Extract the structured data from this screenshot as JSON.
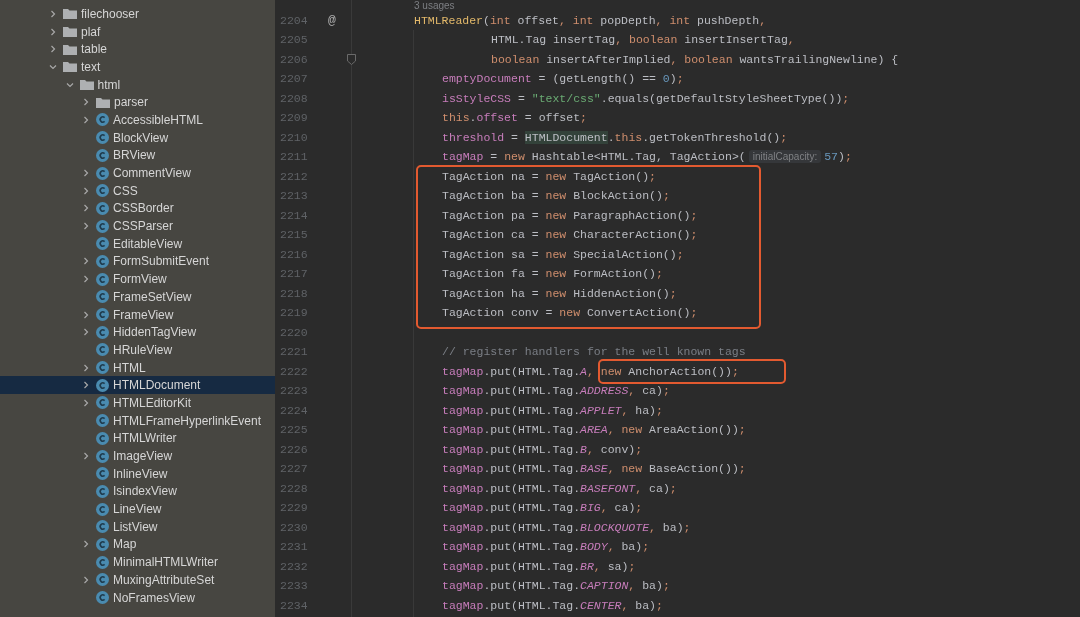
{
  "project_tree": {
    "items": [
      {
        "label": "filechooser",
        "kind": "folder",
        "expanded": false,
        "selected": false
      },
      {
        "label": "plaf",
        "kind": "folder",
        "expanded": false,
        "selected": false
      },
      {
        "label": "table",
        "kind": "folder",
        "expanded": false,
        "selected": false
      },
      {
        "label": "text",
        "kind": "folder",
        "expanded": true,
        "selected": false,
        "children": [
          {
            "label": "html",
            "kind": "folder",
            "expanded": true,
            "selected": false,
            "children": [
              {
                "label": "parser",
                "kind": "folder",
                "expanded": false,
                "selected": false
              },
              {
                "label": "AccessibleHTML",
                "kind": "class",
                "expanded": false,
                "selected": false
              },
              {
                "label": "BlockView",
                "kind": "class",
                "selected": false
              },
              {
                "label": "BRView",
                "kind": "class",
                "selected": false
              },
              {
                "label": "CommentView",
                "kind": "class",
                "expanded": false,
                "selected": false
              },
              {
                "label": "CSS",
                "kind": "class",
                "expanded": false,
                "selected": false
              },
              {
                "label": "CSSBorder",
                "kind": "class",
                "expanded": false,
                "selected": false
              },
              {
                "label": "CSSParser",
                "kind": "class",
                "expanded": false,
                "selected": false
              },
              {
                "label": "EditableView",
                "kind": "class",
                "selected": false
              },
              {
                "label": "FormSubmitEvent",
                "kind": "class",
                "expanded": false,
                "selected": false
              },
              {
                "label": "FormView",
                "kind": "class",
                "expanded": false,
                "selected": false
              },
              {
                "label": "FrameSetView",
                "kind": "class",
                "selected": false
              },
              {
                "label": "FrameView",
                "kind": "class",
                "expanded": false,
                "selected": false
              },
              {
                "label": "HiddenTagView",
                "kind": "class",
                "expanded": false,
                "selected": false
              },
              {
                "label": "HRuleView",
                "kind": "class",
                "selected": false
              },
              {
                "label": "HTML",
                "kind": "class",
                "expanded": false,
                "selected": false
              },
              {
                "label": "HTMLDocument",
                "kind": "class",
                "expanded": false,
                "selected": true
              },
              {
                "label": "HTMLEditorKit",
                "kind": "class",
                "expanded": false,
                "selected": false
              },
              {
                "label": "HTMLFrameHyperlinkEvent",
                "kind": "class",
                "selected": false
              },
              {
                "label": "HTMLWriter",
                "kind": "class",
                "selected": false
              },
              {
                "label": "ImageView",
                "kind": "class",
                "expanded": false,
                "selected": false
              },
              {
                "label": "InlineView",
                "kind": "class",
                "selected": false
              },
              {
                "label": "IsindexView",
                "kind": "class",
                "selected": false
              },
              {
                "label": "LineView",
                "kind": "class",
                "selected": false
              },
              {
                "label": "ListView",
                "kind": "class",
                "selected": false
              },
              {
                "label": "Map",
                "kind": "class",
                "expanded": false,
                "selected": false
              },
              {
                "label": "MinimalHTMLWriter",
                "kind": "class",
                "selected": false
              },
              {
                "label": "MuxingAttributeSet",
                "kind": "class",
                "expanded": false,
                "selected": false
              },
              {
                "label": "NoFramesView",
                "kind": "class",
                "selected": false
              }
            ]
          }
        ]
      }
    ]
  },
  "editor": {
    "usages_hint": "3 usages",
    "lines": [
      {
        "number": "2204",
        "gutter": "@",
        "fold": false,
        "kind": "signature",
        "tokens": [
          {
            "kind": "decl",
            "text": "HTMLReader"
          },
          {
            "kind": "plain",
            "text": "("
          },
          {
            "kind": "keyword",
            "text": "int"
          },
          {
            "kind": "plain",
            "text": " offset"
          },
          {
            "kind": "keyword",
            "text": ", int"
          },
          {
            "kind": "plain",
            "text": " popDepth"
          },
          {
            "kind": "keyword",
            "text": ", int"
          },
          {
            "kind": "plain",
            "text": " pushDepth"
          },
          {
            "kind": "keyword",
            "text": ","
          }
        ]
      },
      {
        "number": "2205",
        "fold": false,
        "kind": "continuation",
        "tokens": [
          {
            "kind": "plain",
            "text": "HTML.Tag insertTag"
          },
          {
            "kind": "keyword",
            "text": ", boolean"
          },
          {
            "kind": "plain",
            "text": " insertInsertTag"
          },
          {
            "kind": "keyword",
            "text": ","
          }
        ]
      },
      {
        "number": "2206",
        "fold": true,
        "kind": "continuation",
        "tokens": [
          {
            "kind": "keyword",
            "text": "boolean"
          },
          {
            "kind": "plain",
            "text": " insertAfterImplied"
          },
          {
            "kind": "keyword",
            "text": ", boolean"
          },
          {
            "kind": "plain",
            "text": " wantsTrailingNewline) {"
          }
        ]
      },
      {
        "number": "2207",
        "fold": false,
        "kind": "body",
        "tokens": [
          {
            "kind": "field",
            "text": "emptyDocument"
          },
          {
            "kind": "plain",
            "text": " = (getLength() == "
          },
          {
            "kind": "number",
            "text": "0"
          },
          {
            "kind": "plain",
            "text": ")"
          },
          {
            "kind": "keyword",
            "text": ";"
          }
        ]
      },
      {
        "number": "2208",
        "fold": false,
        "kind": "body",
        "tokens": [
          {
            "kind": "field",
            "text": "isStyleCSS"
          },
          {
            "kind": "plain",
            "text": " = "
          },
          {
            "kind": "string",
            "text": "\"text/css\""
          },
          {
            "kind": "plain",
            "text": ".equals(getDefaultStyleSheetType())"
          },
          {
            "kind": "keyword",
            "text": ";"
          }
        ]
      },
      {
        "number": "2209",
        "fold": false,
        "kind": "body",
        "tokens": [
          {
            "kind": "keyword",
            "text": "this"
          },
          {
            "kind": "plain",
            "text": "."
          },
          {
            "kind": "field",
            "text": "offset"
          },
          {
            "kind": "plain",
            "text": " = offset"
          },
          {
            "kind": "keyword",
            "text": ";"
          }
        ]
      },
      {
        "number": "2210",
        "fold": false,
        "kind": "body",
        "tokens": [
          {
            "kind": "field",
            "text": "threshold"
          },
          {
            "kind": "plain",
            "text": " = "
          },
          {
            "kind": "highlight",
            "text": "HTMLDocument"
          },
          {
            "kind": "plain",
            "text": "."
          },
          {
            "kind": "keyword",
            "text": "this"
          },
          {
            "kind": "plain",
            "text": ".getTokenThreshold()"
          },
          {
            "kind": "keyword",
            "text": ";"
          }
        ]
      },
      {
        "number": "2211",
        "fold": false,
        "kind": "body",
        "tokens": [
          {
            "kind": "field",
            "text": "tagMap"
          },
          {
            "kind": "plain",
            "text": " = "
          },
          {
            "kind": "keyword",
            "text": "new"
          },
          {
            "kind": "plain",
            "text": " Hashtable<HTML.Tag, TagAction>("
          },
          {
            "kind": "hint",
            "text": "initialCapacity:"
          },
          {
            "kind": "number",
            "text": "57"
          },
          {
            "kind": "plain",
            "text": ")"
          },
          {
            "kind": "keyword",
            "text": ";"
          }
        ]
      },
      {
        "number": "2212",
        "fold": false,
        "kind": "body",
        "tokens": [
          {
            "kind": "plain",
            "text": "TagAction na = "
          },
          {
            "kind": "keyword",
            "text": "new"
          },
          {
            "kind": "plain",
            "text": " TagAction()"
          },
          {
            "kind": "keyword",
            "text": ";"
          }
        ]
      },
      {
        "number": "2213",
        "fold": false,
        "kind": "body",
        "tokens": [
          {
            "kind": "plain",
            "text": "TagAction ba = "
          },
          {
            "kind": "keyword",
            "text": "new"
          },
          {
            "kind": "plain",
            "text": " BlockAction()"
          },
          {
            "kind": "keyword",
            "text": ";"
          }
        ]
      },
      {
        "number": "2214",
        "fold": false,
        "kind": "body",
        "tokens": [
          {
            "kind": "plain",
            "text": "TagAction pa = "
          },
          {
            "kind": "keyword",
            "text": "new"
          },
          {
            "kind": "plain",
            "text": " ParagraphAction()"
          },
          {
            "kind": "keyword",
            "text": ";"
          }
        ]
      },
      {
        "number": "2215",
        "fold": false,
        "kind": "body",
        "tokens": [
          {
            "kind": "plain",
            "text": "TagAction ca = "
          },
          {
            "kind": "keyword",
            "text": "new"
          },
          {
            "kind": "plain",
            "text": " CharacterAction()"
          },
          {
            "kind": "keyword",
            "text": ";"
          }
        ]
      },
      {
        "number": "2216",
        "fold": false,
        "kind": "body",
        "tokens": [
          {
            "kind": "plain",
            "text": "TagAction sa = "
          },
          {
            "kind": "keyword",
            "text": "new"
          },
          {
            "kind": "plain",
            "text": " SpecialAction()"
          },
          {
            "kind": "keyword",
            "text": ";"
          }
        ]
      },
      {
        "number": "2217",
        "fold": false,
        "kind": "body",
        "tokens": [
          {
            "kind": "plain",
            "text": "TagAction fa = "
          },
          {
            "kind": "keyword",
            "text": "new"
          },
          {
            "kind": "plain",
            "text": " FormAction()"
          },
          {
            "kind": "keyword",
            "text": ";"
          }
        ]
      },
      {
        "number": "2218",
        "fold": false,
        "kind": "body",
        "tokens": [
          {
            "kind": "plain",
            "text": "TagAction ha = "
          },
          {
            "kind": "keyword",
            "text": "new"
          },
          {
            "kind": "plain",
            "text": " HiddenAction()"
          },
          {
            "kind": "keyword",
            "text": ";"
          }
        ]
      },
      {
        "number": "2219",
        "fold": false,
        "kind": "body",
        "tokens": [
          {
            "kind": "plain",
            "text": "TagAction conv = "
          },
          {
            "kind": "keyword",
            "text": "new"
          },
          {
            "kind": "plain",
            "text": " ConvertAction()"
          },
          {
            "kind": "keyword",
            "text": ";"
          }
        ]
      },
      {
        "number": "2220",
        "fold": false,
        "kind": "body"
      },
      {
        "number": "2221",
        "fold": false,
        "kind": "body",
        "tokens": [
          {
            "kind": "comment",
            "text": "// register handlers for the well known tags"
          }
        ]
      },
      {
        "number": "2222",
        "fold": false,
        "kind": "body",
        "tokens": [
          {
            "kind": "field",
            "text": "tagMap"
          },
          {
            "kind": "plain",
            "text": ".put(HTML.Tag."
          },
          {
            "kind": "constant",
            "text": "A"
          },
          {
            "kind": "keyword",
            "text": ", new"
          },
          {
            "kind": "plain",
            "text": " AnchorAction())"
          },
          {
            "kind": "keyword",
            "text": ";"
          }
        ]
      },
      {
        "number": "2223",
        "fold": false,
        "kind": "body",
        "tokens": [
          {
            "kind": "field",
            "text": "tagMap"
          },
          {
            "kind": "plain",
            "text": ".put(HTML.Tag."
          },
          {
            "kind": "constant",
            "text": "ADDRESS"
          },
          {
            "kind": "keyword",
            "text": ","
          },
          {
            "kind": "plain",
            "text": " ca)"
          },
          {
            "kind": "keyword",
            "text": ";"
          }
        ]
      },
      {
        "number": "2224",
        "fold": false,
        "kind": "body",
        "tokens": [
          {
            "kind": "field",
            "text": "tagMap"
          },
          {
            "kind": "plain",
            "text": ".put(HTML.Tag."
          },
          {
            "kind": "constant",
            "text": "APPLET"
          },
          {
            "kind": "keyword",
            "text": ","
          },
          {
            "kind": "plain",
            "text": " ha)"
          },
          {
            "kind": "keyword",
            "text": ";"
          }
        ]
      },
      {
        "number": "2225",
        "fold": false,
        "kind": "body",
        "tokens": [
          {
            "kind": "field",
            "text": "tagMap"
          },
          {
            "kind": "plain",
            "text": ".put(HTML.Tag."
          },
          {
            "kind": "constant",
            "text": "AREA"
          },
          {
            "kind": "keyword",
            "text": ", new"
          },
          {
            "kind": "plain",
            "text": " AreaAction())"
          },
          {
            "kind": "keyword",
            "text": ";"
          }
        ]
      },
      {
        "number": "2226",
        "fold": false,
        "kind": "body",
        "tokens": [
          {
            "kind": "field",
            "text": "tagMap"
          },
          {
            "kind": "plain",
            "text": ".put(HTML.Tag."
          },
          {
            "kind": "constant",
            "text": "B"
          },
          {
            "kind": "keyword",
            "text": ","
          },
          {
            "kind": "plain",
            "text": " conv)"
          },
          {
            "kind": "keyword",
            "text": ";"
          }
        ]
      },
      {
        "number": "2227",
        "fold": false,
        "kind": "body",
        "tokens": [
          {
            "kind": "field",
            "text": "tagMap"
          },
          {
            "kind": "plain",
            "text": ".put(HTML.Tag."
          },
          {
            "kind": "constant",
            "text": "BASE"
          },
          {
            "kind": "keyword",
            "text": ", new"
          },
          {
            "kind": "plain",
            "text": " BaseAction())"
          },
          {
            "kind": "keyword",
            "text": ";"
          }
        ]
      },
      {
        "number": "2228",
        "fold": false,
        "kind": "body",
        "tokens": [
          {
            "kind": "field",
            "text": "tagMap"
          },
          {
            "kind": "plain",
            "text": ".put(HTML.Tag."
          },
          {
            "kind": "constant",
            "text": "BASEFONT"
          },
          {
            "kind": "keyword",
            "text": ","
          },
          {
            "kind": "plain",
            "text": " ca)"
          },
          {
            "kind": "keyword",
            "text": ";"
          }
        ]
      },
      {
        "number": "2229",
        "fold": false,
        "kind": "body",
        "tokens": [
          {
            "kind": "field",
            "text": "tagMap"
          },
          {
            "kind": "plain",
            "text": ".put(HTML.Tag."
          },
          {
            "kind": "constant",
            "text": "BIG"
          },
          {
            "kind": "keyword",
            "text": ","
          },
          {
            "kind": "plain",
            "text": " ca)"
          },
          {
            "kind": "keyword",
            "text": ";"
          }
        ]
      },
      {
        "number": "2230",
        "fold": false,
        "kind": "body",
        "tokens": [
          {
            "kind": "field",
            "text": "tagMap"
          },
          {
            "kind": "plain",
            "text": ".put(HTML.Tag."
          },
          {
            "kind": "constant",
            "text": "BLOCKQUOTE"
          },
          {
            "kind": "keyword",
            "text": ","
          },
          {
            "kind": "plain",
            "text": " ba)"
          },
          {
            "kind": "keyword",
            "text": ";"
          }
        ]
      },
      {
        "number": "2231",
        "fold": false,
        "kind": "body",
        "tokens": [
          {
            "kind": "field",
            "text": "tagMap"
          },
          {
            "kind": "plain",
            "text": ".put(HTML.Tag."
          },
          {
            "kind": "constant",
            "text": "BODY"
          },
          {
            "kind": "keyword",
            "text": ","
          },
          {
            "kind": "plain",
            "text": " ba)"
          },
          {
            "kind": "keyword",
            "text": ";"
          }
        ]
      },
      {
        "number": "2232",
        "fold": false,
        "kind": "body",
        "tokens": [
          {
            "kind": "field",
            "text": "tagMap"
          },
          {
            "kind": "plain",
            "text": ".put(HTML.Tag."
          },
          {
            "kind": "constant",
            "text": "BR"
          },
          {
            "kind": "keyword",
            "text": ","
          },
          {
            "kind": "plain",
            "text": " sa)"
          },
          {
            "kind": "keyword",
            "text": ";"
          }
        ]
      },
      {
        "number": "2233",
        "fold": false,
        "kind": "body",
        "tokens": [
          {
            "kind": "field",
            "text": "tagMap"
          },
          {
            "kind": "plain",
            "text": ".put(HTML.Tag."
          },
          {
            "kind": "constant",
            "text": "CAPTION"
          },
          {
            "kind": "keyword",
            "text": ","
          },
          {
            "kind": "plain",
            "text": " ba)"
          },
          {
            "kind": "keyword",
            "text": ";"
          }
        ]
      },
      {
        "number": "2234",
        "fold": false,
        "kind": "body",
        "tokens": [
          {
            "kind": "field",
            "text": "tagMap"
          },
          {
            "kind": "plain",
            "text": ".put(HTML.Tag."
          },
          {
            "kind": "constant",
            "text": "CENTER"
          },
          {
            "kind": "keyword",
            "text": ","
          },
          {
            "kind": "plain",
            "text": " ba)"
          },
          {
            "kind": "keyword",
            "text": ";"
          }
        ]
      }
    ]
  }
}
